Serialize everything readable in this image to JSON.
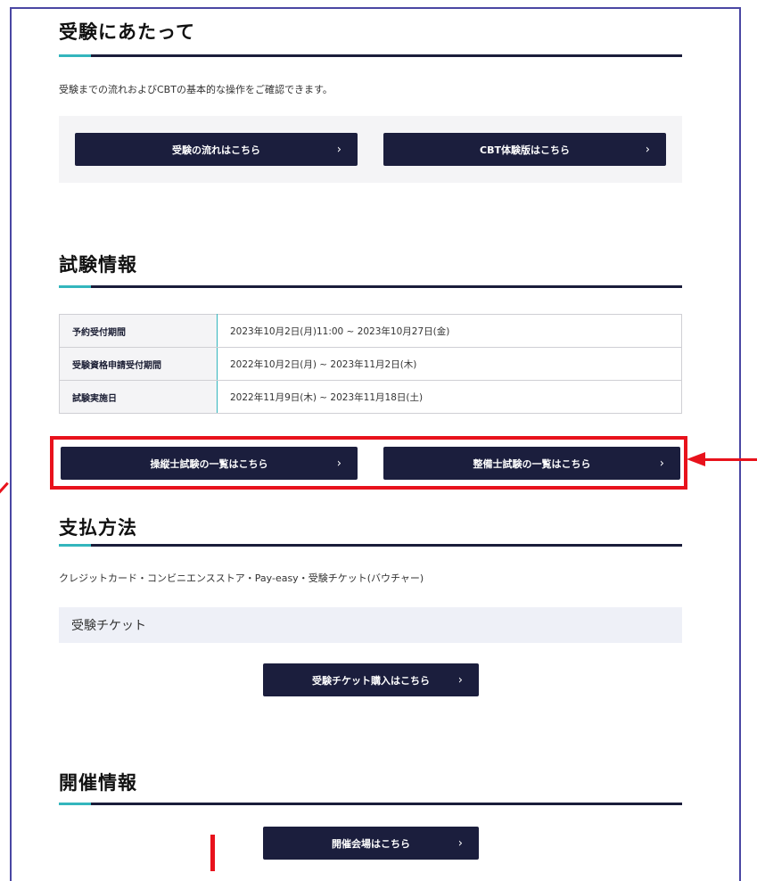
{
  "sections": {
    "exam_prep": {
      "heading": "受験にあたって",
      "description": "受験までの流れおよびCBTの基本的な操作をご確認できます。",
      "buttons": [
        {
          "label": "受験の流れはこちら"
        },
        {
          "label": "CBT体験版はこちら"
        }
      ]
    },
    "exam_info": {
      "heading": "試験情報",
      "table": [
        {
          "label": "予約受付期間",
          "value": "2023年10月2日(月)11:00 ~ 2023年10月27日(金)"
        },
        {
          "label": "受験資格申請受付期間",
          "value": "2022年10月2日(月) ~ 2023年11月2日(木)"
        },
        {
          "label": "試験実施日",
          "value": "2022年11月9日(木) ~ 2023年11月18日(土)"
        }
      ],
      "buttons": [
        {
          "label": "操縦士試験の一覧はこちら"
        },
        {
          "label": "整備士試験の一覧はこちら"
        }
      ]
    },
    "payment": {
      "heading": "支払方法",
      "description": "クレジットカード・コンビニエンスストア・Pay-easy・受験チケット(バウチャー)",
      "ticket_title": "受験チケット",
      "ticket_button": "受験チケット購入はこちら"
    },
    "venue": {
      "heading": "開催情報",
      "button": "開催会場はこちら"
    }
  },
  "chevron": "›",
  "colors": {
    "button_bg": "#1b1e3d",
    "accent": "#33b6bd",
    "annotation": "#e8121c",
    "frame": "#4a47a3"
  }
}
